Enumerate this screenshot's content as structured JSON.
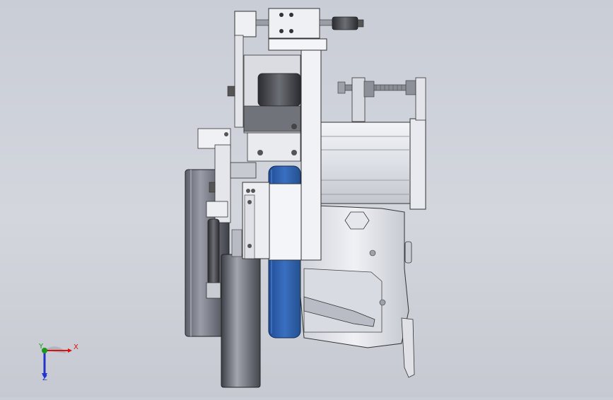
{
  "viewport": {
    "background_top": "#c9cdd6",
    "background_bottom": "#c6c9d1"
  },
  "triad": {
    "x_label": "X",
    "y_label": "Y",
    "z_label": "Z",
    "x_color": "#dd1111",
    "y_color": "#1a9a1a",
    "z_color": "#2233cc"
  },
  "model": {
    "wheel_blue_color": "#2f5fae",
    "body_color": "#e4e6ec",
    "drum_color": "#7d808a"
  }
}
